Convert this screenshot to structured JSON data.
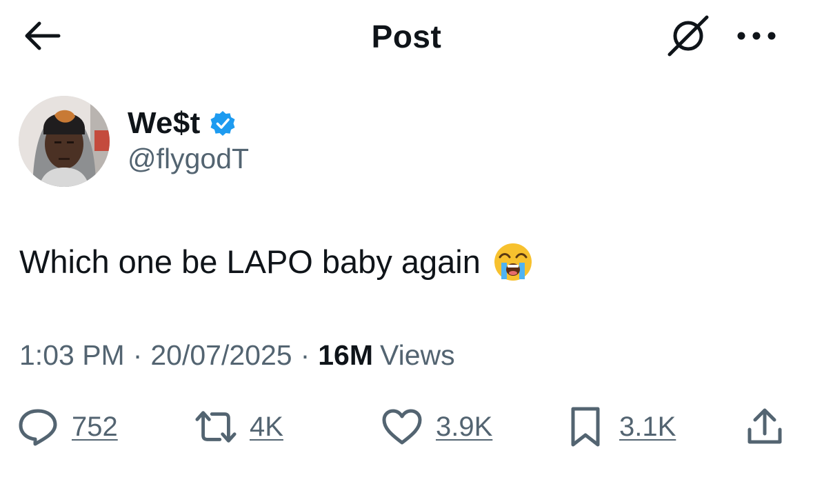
{
  "header": {
    "title": "Post",
    "back_icon": "arrow-left-icon",
    "grok_icon": "grok-icon",
    "more_icon": "more-horizontal-icon"
  },
  "author": {
    "name": "We$t",
    "handle": "@flygodT",
    "verified": true,
    "verified_color": "#1d9bf0"
  },
  "post": {
    "text": "Which one be LAPO baby again",
    "emoji": "loudly-crying-face"
  },
  "meta": {
    "time": "1:03 PM",
    "date": "20/07/2025",
    "views_count": "16M",
    "views_label": "Views",
    "separator": "·"
  },
  "actions": {
    "replies": "752",
    "reposts": "4K",
    "likes": "3.9K",
    "bookmarks": "3.1K"
  },
  "colors": {
    "text_primary": "#0f1419",
    "text_secondary": "#536471",
    "background": "#ffffff"
  }
}
